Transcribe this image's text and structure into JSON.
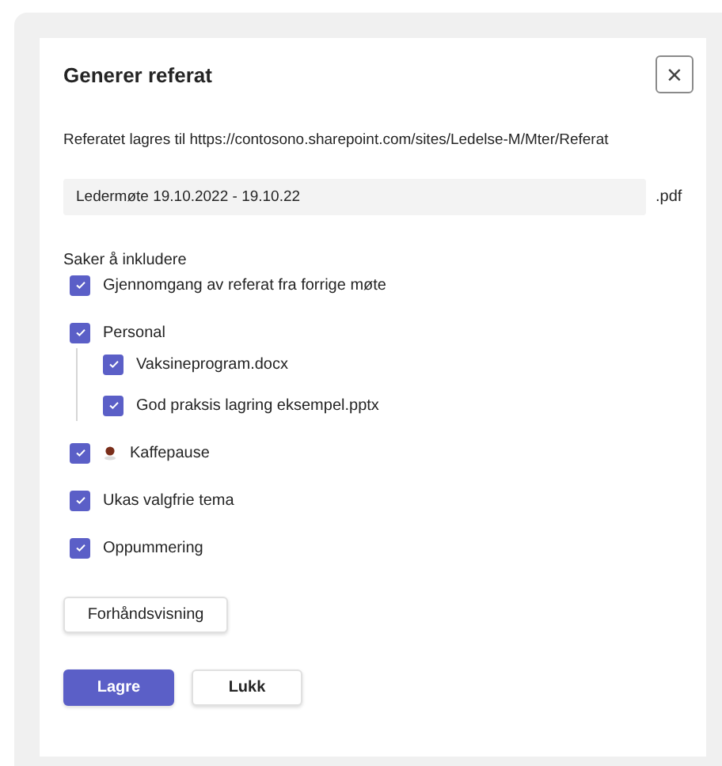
{
  "dialog": {
    "title": "Generer referat",
    "close_label": "×",
    "save_location": "Referatet lagres til https://contosono.sharepoint.com/sites/Ledelse-M/Mter/Referat",
    "file_name": {
      "value": "Ledermøte 19.10.2022 - 19.10.22",
      "extension": ".pdf"
    },
    "section_label": "Saker å inkludere",
    "items": [
      {
        "label": "Gjennomgang av referat fra forrige møte",
        "checked": true,
        "kind": "text"
      },
      {
        "label": "Personal",
        "checked": true,
        "kind": "text",
        "children": [
          {
            "label": "Vaksineprogram.docx",
            "checked": true
          },
          {
            "label": "God praksis lagring eksempel.pptx",
            "checked": true
          }
        ]
      },
      {
        "label": "Kaffepause",
        "checked": true,
        "kind": "icon"
      },
      {
        "label": "Ukas valgfrie tema",
        "checked": true,
        "kind": "text"
      },
      {
        "label": "Oppummering",
        "checked": true,
        "kind": "text"
      }
    ],
    "preview_button": "Forhåndsvisning",
    "buttons": [
      {
        "label": "Lagre",
        "kind": "primary"
      },
      {
        "label": "Lukk",
        "kind": "secondary"
      }
    ]
  }
}
